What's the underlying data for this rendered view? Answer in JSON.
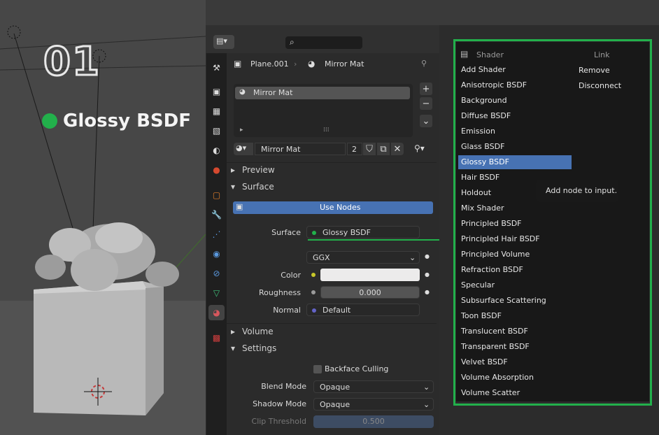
{
  "overlay": {
    "step_number": "01",
    "highlight_label": "Glossy BSDF",
    "highlight_color": "#22b04b"
  },
  "header": {
    "search_placeholder": ""
  },
  "breadcrumb": {
    "object": "Plane.001",
    "material": "Mirror Mat"
  },
  "material_slots": {
    "items": [
      "Mirror Mat"
    ]
  },
  "datablock": {
    "name": "Mirror Mat",
    "users": "2"
  },
  "sections": {
    "preview": "Preview",
    "surface": "Surface",
    "volume": "Volume",
    "settings": "Settings"
  },
  "surface": {
    "use_nodes_label": "Use Nodes",
    "surface_label": "Surface",
    "surface_value": "Glossy BSDF",
    "distribution": "GGX",
    "color_label": "Color",
    "color_value": "#ecebeb",
    "roughness_label": "Roughness",
    "roughness_value": "0.000",
    "normal_label": "Normal",
    "normal_value": "Default"
  },
  "settings": {
    "backface_label": "Backface Culling",
    "blend_mode_label": "Blend Mode",
    "blend_mode_value": "Opaque",
    "shadow_mode_label": "Shadow Mode",
    "shadow_mode_value": "Opaque",
    "clip_label": "Clip Threshold",
    "clip_value": "0.500"
  },
  "menu": {
    "shader_header": "Shader",
    "link_header": "Link",
    "shader_items": [
      "Add Shader",
      "Anisotropic BSDF",
      "Background",
      "Diffuse BSDF",
      "Emission",
      "Glass BSDF",
      "Glossy BSDF",
      "Hair BSDF",
      "Holdout",
      "Mix Shader",
      "Principled BSDF",
      "Principled Hair BSDF",
      "Principled Volume",
      "Refraction BSDF",
      "Specular",
      "Subsurface Scattering",
      "Toon BSDF",
      "Translucent BSDF",
      "Transparent BSDF",
      "Velvet BSDF",
      "Volume Absorption",
      "Volume Scatter"
    ],
    "selected_index": 6,
    "link_items": [
      "Remove",
      "Disconnect"
    ],
    "tooltip": "Add node to input."
  },
  "colors": {
    "accent": "#4772b3",
    "frame": "#22b04b"
  }
}
